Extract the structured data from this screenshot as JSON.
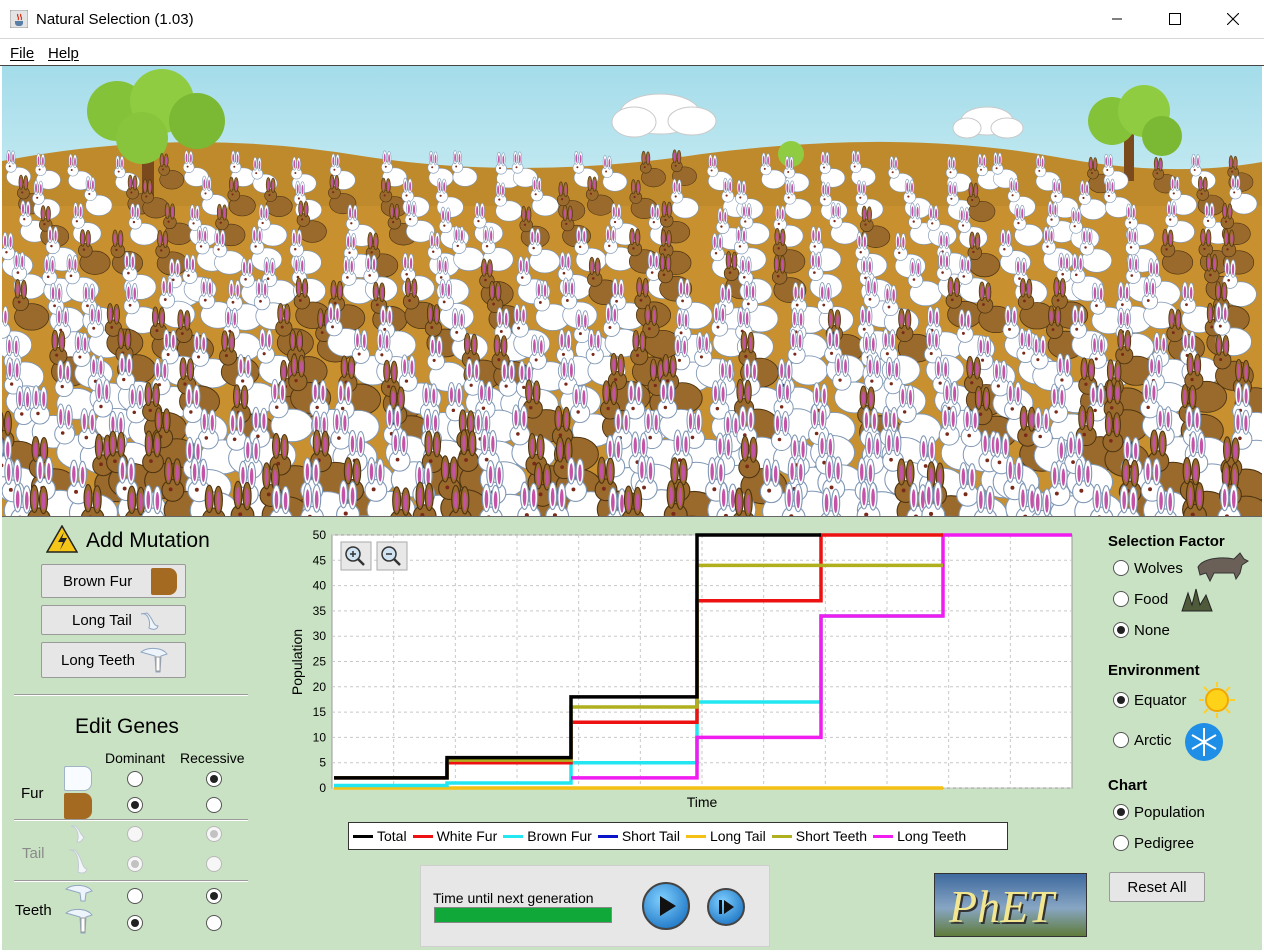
{
  "window": {
    "title": "Natural Selection (1.03)"
  },
  "menu": {
    "items": [
      "File",
      "Help"
    ]
  },
  "mutation": {
    "heading": "Add Mutation",
    "buttons": [
      "Brown Fur",
      "Long Tail",
      "Long Teeth"
    ]
  },
  "genes": {
    "heading": "Edit Genes",
    "columns": [
      "Dominant",
      "Recessive"
    ],
    "rows": [
      {
        "label": "Fur",
        "enabled": true,
        "dominant_top": false,
        "recessive_top": true,
        "dominant_bottom": true,
        "recessive_bottom": false
      },
      {
        "label": "Tail",
        "enabled": false,
        "dominant_top": false,
        "recessive_top": true,
        "dominant_bottom": true,
        "recessive_bottom": false
      },
      {
        "label": "Teeth",
        "enabled": true,
        "dominant_top": false,
        "recessive_top": true,
        "dominant_bottom": true,
        "recessive_bottom": false
      }
    ]
  },
  "chart_data": {
    "type": "line",
    "xlabel": "Time",
    "ylabel": "Population",
    "ylim": [
      0,
      50
    ],
    "y_ticks": [
      "0",
      "5",
      "10",
      "15",
      "20",
      "25",
      "30",
      "35",
      "40",
      "45",
      "50"
    ],
    "grid": true,
    "legend_position": "bottom",
    "series": [
      {
        "name": "Total",
        "color": "#000000",
        "steps": [
          [
            0,
            2
          ],
          [
            1,
            6
          ],
          [
            2,
            18
          ],
          [
            3,
            50
          ]
        ]
      },
      {
        "name": "White Fur",
        "color": "#ee1111",
        "steps": [
          [
            0,
            2
          ],
          [
            1,
            5
          ],
          [
            2,
            13
          ],
          [
            3,
            37
          ],
          [
            4,
            50
          ]
        ]
      },
      {
        "name": "Brown Fur",
        "color": "#22e6f0",
        "steps": [
          [
            0,
            0.5
          ],
          [
            1,
            1
          ],
          [
            2,
            5
          ],
          [
            3,
            17
          ],
          [
            4,
            34
          ]
        ]
      },
      {
        "name": "Short Tail",
        "color": "#0a14c8",
        "steps": []
      },
      {
        "name": "Long Tail",
        "color": "#f5c014",
        "steps": [
          [
            0,
            0
          ],
          [
            4,
            0
          ]
        ]
      },
      {
        "name": "Short Teeth",
        "color": "#b0b01e",
        "steps": [
          [
            0,
            2
          ],
          [
            1,
            5.5
          ],
          [
            2,
            16
          ],
          [
            3,
            44
          ],
          [
            4,
            44
          ]
        ]
      },
      {
        "name": "Long Teeth",
        "color": "#f01cf0",
        "steps": [
          [
            2,
            2
          ],
          [
            3,
            10
          ],
          [
            4,
            34
          ],
          [
            5,
            50
          ]
        ]
      }
    ]
  },
  "timer": {
    "label": "Time until next generation",
    "progress": 1.0
  },
  "selection_factor": {
    "heading": "Selection Factor",
    "options": [
      "Wolves",
      "Food",
      "None"
    ],
    "selected": "None"
  },
  "environment": {
    "heading": "Environment",
    "options": [
      "Equator",
      "Arctic"
    ],
    "selected": "Equator"
  },
  "chart_choice": {
    "heading": "Chart",
    "options": [
      "Population",
      "Pedigree"
    ],
    "selected": "Population"
  },
  "reset_label": "Reset All",
  "logo_text": "PhET",
  "colors": {
    "panel": "#c9e2c4",
    "sky": "#a9dcea",
    "ground": "#c8902e",
    "brown_bunny": "#9a6a2c",
    "white_bunny": "#ffffff"
  }
}
